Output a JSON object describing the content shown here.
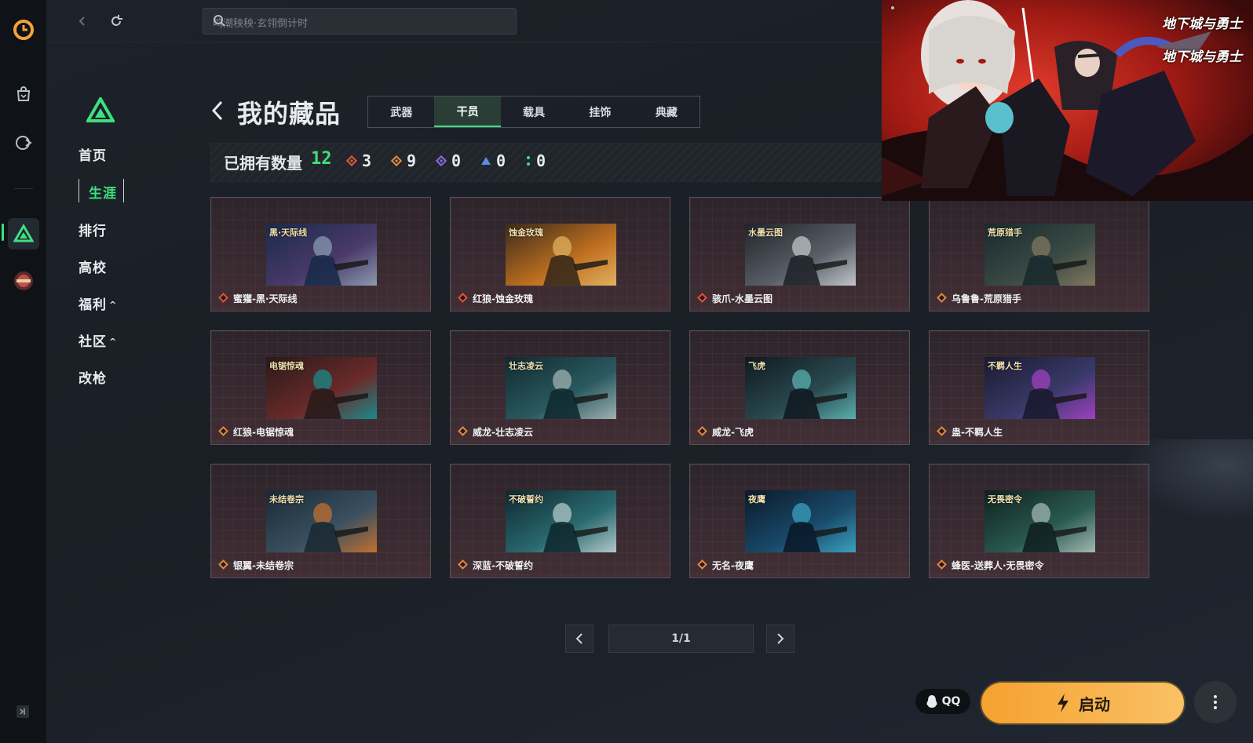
{
  "topbar": {
    "search_placeholder": "鸣潮秧秧·玄翎倒计时"
  },
  "nav": {
    "items": [
      {
        "label": "首页"
      },
      {
        "label": "生涯",
        "selected": true
      },
      {
        "label": "排行"
      },
      {
        "label": "高校"
      },
      {
        "label": "福利",
        "expandable": true
      },
      {
        "label": "社区",
        "expandable": true
      },
      {
        "label": "改枪"
      }
    ]
  },
  "page": {
    "title": "我的藏品",
    "tabs": [
      "武器",
      "干员",
      "载具",
      "挂饰",
      "典藏"
    ],
    "active_tab": "干员"
  },
  "stats": {
    "owned_label": "已拥有数量",
    "owned_count": "12",
    "rarities": [
      {
        "value": "3",
        "color": "#e0523f"
      },
      {
        "value": "9",
        "color": "#e08a3f"
      },
      {
        "value": "0",
        "color": "#8b6ae0"
      },
      {
        "value": "0",
        "color": "#5a8ee0"
      },
      {
        "value": "0",
        "color": "#3ee07e"
      }
    ]
  },
  "collection": {
    "items": [
      {
        "name": "蜜獾-黑·天际线",
        "rarity_color": "#e0523f",
        "art_tag": "黑·天际线",
        "art_colors": [
          "#1a2a4a",
          "#4a3a6a",
          "#8a9ab0"
        ]
      },
      {
        "name": "红狼-蚀金玫瑰",
        "rarity_color": "#e0523f",
        "art_tag": "蚀金玫瑰",
        "art_colors": [
          "#3a2a1a",
          "#c07020",
          "#e0b060"
        ]
      },
      {
        "name": "骇爪-水墨云图",
        "rarity_color": "#e0523f",
        "art_tag": "水墨云图",
        "art_colors": [
          "#20242a",
          "#5a6068",
          "#c0c4c8"
        ]
      },
      {
        "name": "乌鲁鲁-荒原猎手",
        "rarity_color": "#e08a3f",
        "art_tag": "荒原猎手",
        "art_colors": [
          "#1a2a2e",
          "#3a4a44",
          "#807860"
        ]
      },
      {
        "name": "红狼-电锯惊魂",
        "rarity_color": "#e08a3f",
        "art_tag": "电锯惊魂",
        "art_colors": [
          "#2a1a1a",
          "#6a2a2a",
          "#1a8a8a"
        ]
      },
      {
        "name": "威龙-壮志凌云",
        "rarity_color": "#e08a3f",
        "art_tag": "壮志凌云",
        "art_colors": [
          "#102a30",
          "#2a5a60",
          "#a0b0b0"
        ]
      },
      {
        "name": "威龙-飞虎",
        "rarity_color": "#e08a3f",
        "art_tag": "飞虎",
        "art_colors": [
          "#101a20",
          "#2a4a50",
          "#5ab0b0"
        ]
      },
      {
        "name": "蛊-不羁人生",
        "rarity_color": "#e08a3f",
        "art_tag": "不羁人生",
        "art_colors": [
          "#1a1a30",
          "#3a3a6a",
          "#a040c0"
        ]
      },
      {
        "name": "银翼-未结卷宗",
        "rarity_color": "#e08a3f",
        "art_tag": "未结卷宗",
        "art_colors": [
          "#1a2a34",
          "#3a5060",
          "#c07030"
        ]
      },
      {
        "name": "深蓝-不破誓约",
        "rarity_color": "#e08a3f",
        "art_tag": "不破誓约",
        "art_colors": [
          "#102830",
          "#2a6a70",
          "#b0c8c8"
        ]
      },
      {
        "name": "无名-夜鹰",
        "rarity_color": "#e08a3f",
        "art_tag": "夜鹰",
        "art_colors": [
          "#0a1a2a",
          "#1a4a6a",
          "#3aa0c0"
        ]
      },
      {
        "name": "蜂医-送葬人·无畏密令",
        "rarity_color": "#e08a3f",
        "art_tag": "无畏密令",
        "art_colors": [
          "#102020",
          "#2a5a50",
          "#a0b8b0"
        ]
      }
    ]
  },
  "pagination": {
    "label": "1/1",
    "current": 1,
    "total": 1
  },
  "banner": {
    "logo_text_1": "地下城与勇士",
    "logo_text_2": "地下城与勇士"
  },
  "footer": {
    "qq_label": "QQ",
    "launch_label": "启动"
  },
  "colors": {
    "accent_green": "#3ee07e",
    "launch_orange": "#f6a12f"
  }
}
